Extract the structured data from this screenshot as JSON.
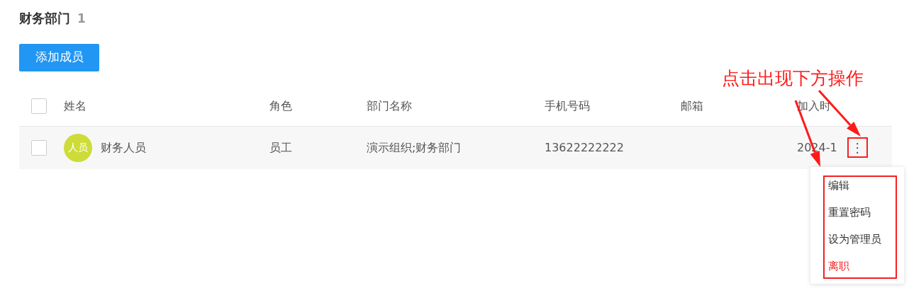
{
  "title": "财务部门",
  "count": "1",
  "add_button": "添加成员",
  "table": {
    "select_all": {
      "checked": false
    },
    "columns": [
      "姓名",
      "角色",
      "部门名称",
      "手机号码",
      "邮箱",
      "加入时"
    ],
    "rows": [
      {
        "checked": false,
        "avatar": "人员",
        "name": "财务人员",
        "role": "员工",
        "department": "演示组织;财务部门",
        "phone": "13622222222",
        "join": "2024-1",
        "more": "⋮"
      }
    ]
  },
  "menu": {
    "items": [
      {
        "label": "编辑",
        "kind": "normal"
      },
      {
        "label": "重置密码",
        "kind": "normal"
      },
      {
        "label": "设为管理员",
        "kind": "normal"
      },
      {
        "label": "离职",
        "kind": "danger"
      }
    ]
  },
  "annotation": "点击出现下方操作"
}
